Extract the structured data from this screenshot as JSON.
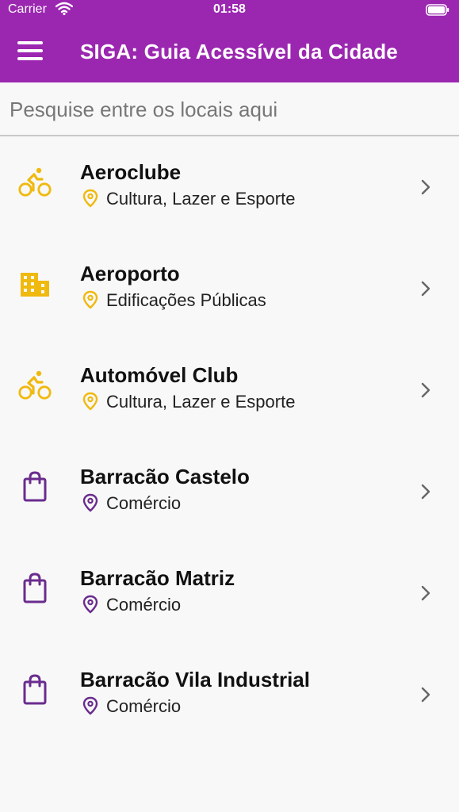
{
  "status_bar": {
    "carrier": "Carrier",
    "time": "01:58"
  },
  "app_bar": {
    "title": "SIGA: Guia Acessível da Cidade"
  },
  "search": {
    "placeholder": "Pesquise entre os locais aqui",
    "value": ""
  },
  "colors": {
    "primary": "#9b27b0",
    "yellow": "#f0b90e",
    "purple": "#6a2c8e"
  },
  "places": [
    {
      "name": "Aeroclube",
      "category": "Cultura, Lazer e Esporte",
      "icon": "bike-icon"
    },
    {
      "name": "Aeroporto",
      "category": "Edificações Públicas",
      "icon": "building-icon"
    },
    {
      "name": "Automóvel Club",
      "category": "Cultura, Lazer e Esporte",
      "icon": "bike-icon"
    },
    {
      "name": "Barracão Castelo",
      "category": "Comércio",
      "icon": "shopping-bag-icon"
    },
    {
      "name": "Barracão Matriz",
      "category": "Comércio",
      "icon": "shopping-bag-icon"
    },
    {
      "name": "Barracão Vila Industrial",
      "category": "Comércio",
      "icon": "shopping-bag-icon"
    }
  ]
}
